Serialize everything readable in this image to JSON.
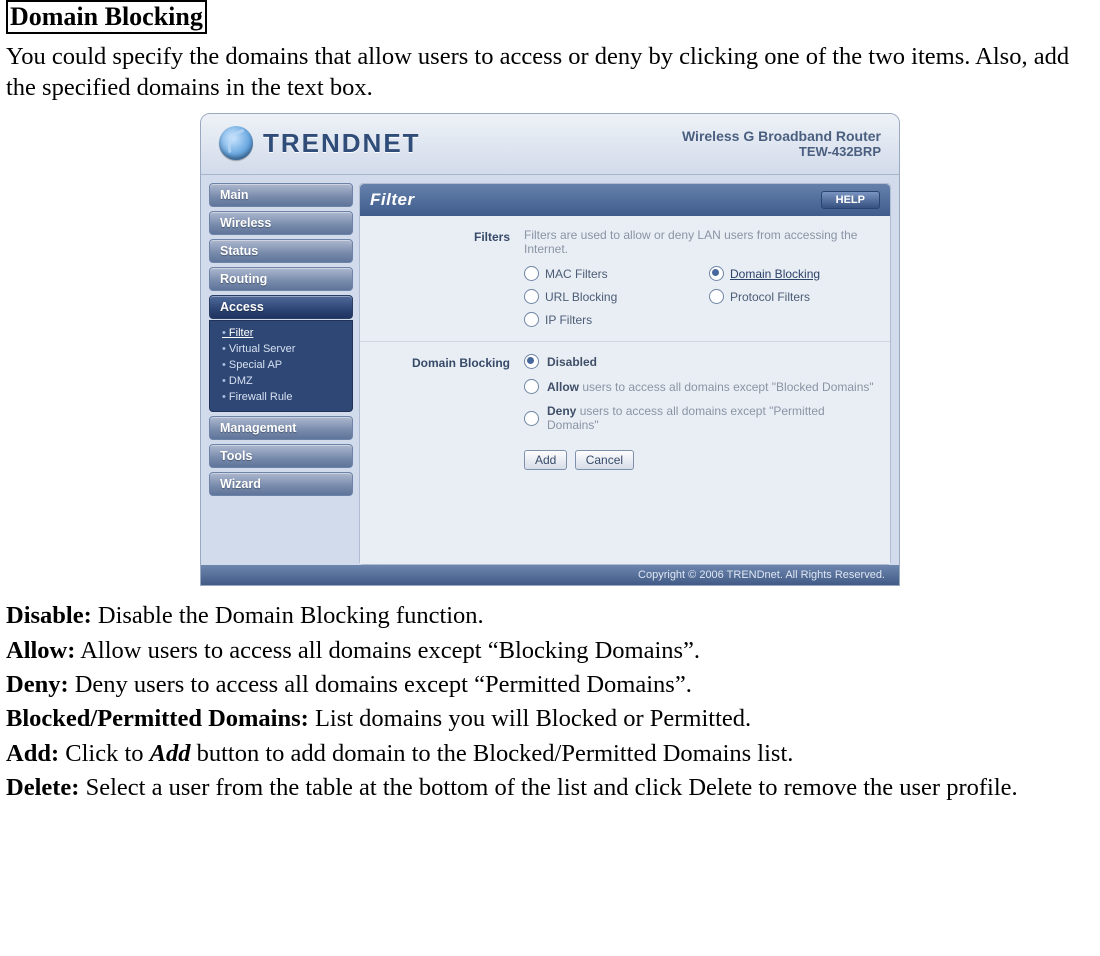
{
  "doc": {
    "heading": "Domain Blocking",
    "intro": "You could specify the domains that allow users to access or deny by clicking one of the two items.  Also, add the specified domains in the text box.",
    "defs": {
      "disable_label": "Disable:",
      "disable_text": " Disable the Domain Blocking function.",
      "allow_label": "Allow:",
      "allow_text": " Allow users to access all domains except “Blocking Domains”.",
      "deny_label": "Deny:",
      "deny_text": " Deny users to access all domains except “Permitted Domains”.",
      "bp_label": "Blocked/Permitted Domains:",
      "bp_text": " List domains you will Blocked or Permitted.",
      "add_label": "Add:",
      "add_text_pre": " Click to ",
      "add_text_em": "Add",
      "add_text_post": " button to add domain to the Blocked/Permitted Domains list.",
      "delete_label": "Delete:",
      "delete_text": " Select a user from the table at the bottom of the list and click Delete to remove the user profile."
    }
  },
  "router": {
    "brand": "TRENDNET",
    "product_line": "Wireless G Broadband Router",
    "model": "TEW-432BRP",
    "footer": "Copyright © 2006 TRENDnet. All Rights Reserved.",
    "help_label": "HELP",
    "nav": {
      "main": "Main",
      "wireless": "Wireless",
      "status": "Status",
      "routing": "Routing",
      "access": "Access",
      "management": "Management",
      "tools": "Tools",
      "wizard": "Wizard"
    },
    "subnav": {
      "filter": "Filter",
      "virtual_server": "Virtual Server",
      "special_ap": "Special AP",
      "dmz": "DMZ",
      "firewall_rule": "Firewall Rule"
    },
    "panel": {
      "title": "Filter",
      "filters_section_label": "Filters",
      "filters_desc": "Filters are used to allow or deny LAN users from accessing the Internet.",
      "options": {
        "mac": "MAC Filters",
        "domain": "Domain Blocking",
        "url": "URL Blocking",
        "protocol": "Protocol Filters",
        "ip": "IP Filters"
      },
      "db_section_label": "Domain Blocking",
      "db_disabled": "Disabled",
      "db_allow_b": "Allow ",
      "db_allow_rest": "users to access all domains except \"Blocked Domains\"",
      "db_deny_b": "Deny ",
      "db_deny_rest": "users to access all domains except \"Permitted Domains\"",
      "btn_add": "Add",
      "btn_cancel": "Cancel"
    }
  }
}
